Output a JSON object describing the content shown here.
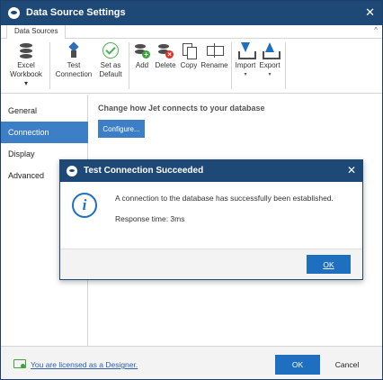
{
  "window": {
    "title": "Data Source Settings",
    "close_glyph": "✕"
  },
  "ribbon": {
    "tab": "Data Sources",
    "collapse_glyph": "^",
    "buttons": [
      {
        "id": "excel-workbook",
        "line1": "Excel",
        "line2": "Workbook ▾",
        "icon": "database-icon"
      },
      {
        "id": "test-connection",
        "line1": "Test",
        "line2": "Connection",
        "icon": "test-connection-icon"
      },
      {
        "id": "set-as-default",
        "line1": "Set as",
        "line2": "Default",
        "icon": "checkmark-icon"
      },
      {
        "id": "add",
        "line1": "Add",
        "line2": "",
        "icon": "add-database-icon"
      },
      {
        "id": "delete",
        "line1": "Delete",
        "line2": "",
        "icon": "delete-database-icon"
      },
      {
        "id": "copy",
        "line1": "Copy",
        "line2": "",
        "icon": "copy-icon"
      },
      {
        "id": "rename",
        "line1": "Rename",
        "line2": "",
        "icon": "rename-icon"
      },
      {
        "id": "import",
        "line1": "Import",
        "line2": "▾",
        "icon": "import-icon"
      },
      {
        "id": "export",
        "line1": "Export",
        "line2": "▾",
        "icon": "export-icon"
      }
    ]
  },
  "nav": {
    "items": [
      {
        "label": "General",
        "active": false
      },
      {
        "label": "Connection",
        "active": true
      },
      {
        "label": "Display",
        "active": false
      },
      {
        "label": "Advanced",
        "active": false
      }
    ]
  },
  "content": {
    "heading": "Change how Jet connects to your database",
    "configure_label": "Configure..."
  },
  "footer": {
    "license_link": "You are licensed as a Designer.",
    "ok_label": "OK",
    "cancel_label": "Cancel"
  },
  "dialog": {
    "title": "Test Connection Succeeded",
    "close_glyph": "✕",
    "info_glyph": "i",
    "message": "A connection to the database has successfully been established.",
    "response": "Response time: 3ms",
    "ok_label": "OK"
  },
  "colors": {
    "titlebar": "#1e4876",
    "accent": "#3c7fc6",
    "primary_button": "#1f6fc0",
    "success": "#3da33d",
    "danger": "#d9342b"
  }
}
